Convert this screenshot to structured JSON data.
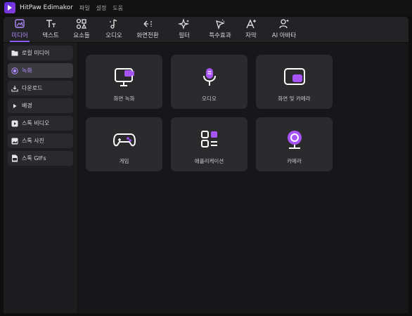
{
  "app": {
    "title": "HitPaw Edimakor",
    "menu": [
      "파일",
      "설정",
      "도움"
    ]
  },
  "tabs": [
    {
      "label": "미디어",
      "icon": "media-icon"
    },
    {
      "label": "텍스트",
      "icon": "text-icon"
    },
    {
      "label": "요소들",
      "icon": "elements-icon"
    },
    {
      "label": "오디오",
      "icon": "audio-icon"
    },
    {
      "label": "화면전환",
      "icon": "transition-icon"
    },
    {
      "label": "필터",
      "icon": "filter-icon"
    },
    {
      "label": "특수효과",
      "icon": "effects-icon"
    },
    {
      "label": "자막",
      "icon": "subtitle-icon"
    },
    {
      "label": "AI 아바타",
      "icon": "ai-avatar-icon"
    }
  ],
  "sidebar": {
    "items": [
      {
        "label": "로컬 미디어",
        "icon": "folder-icon"
      },
      {
        "label": "녹화",
        "icon": "record-icon"
      },
      {
        "label": "다운로드",
        "icon": "download-icon"
      },
      {
        "label": "배경",
        "icon": "play-triangle-icon"
      },
      {
        "label": "스톡 비디오",
        "icon": "video-play-icon"
      },
      {
        "label": "스톡 사진",
        "icon": "image-icon"
      },
      {
        "label": "스톡 GIFs",
        "icon": "gif-icon"
      }
    ]
  },
  "cards": [
    {
      "label": "화면 녹화",
      "icon": "screen-record-icon"
    },
    {
      "label": "오디오",
      "icon": "microphone-icon"
    },
    {
      "label": "화면 및 카메라",
      "icon": "screen-camera-icon"
    },
    {
      "label": "게임",
      "icon": "gamepad-icon"
    },
    {
      "label": "애플리케이션",
      "icon": "apps-icon"
    },
    {
      "label": "카메라",
      "icon": "webcam-icon"
    }
  ],
  "colors": {
    "accent": "#8b5cf6",
    "accent_light": "#b08cff",
    "panel": "#232326",
    "card": "#2b2b2e"
  }
}
